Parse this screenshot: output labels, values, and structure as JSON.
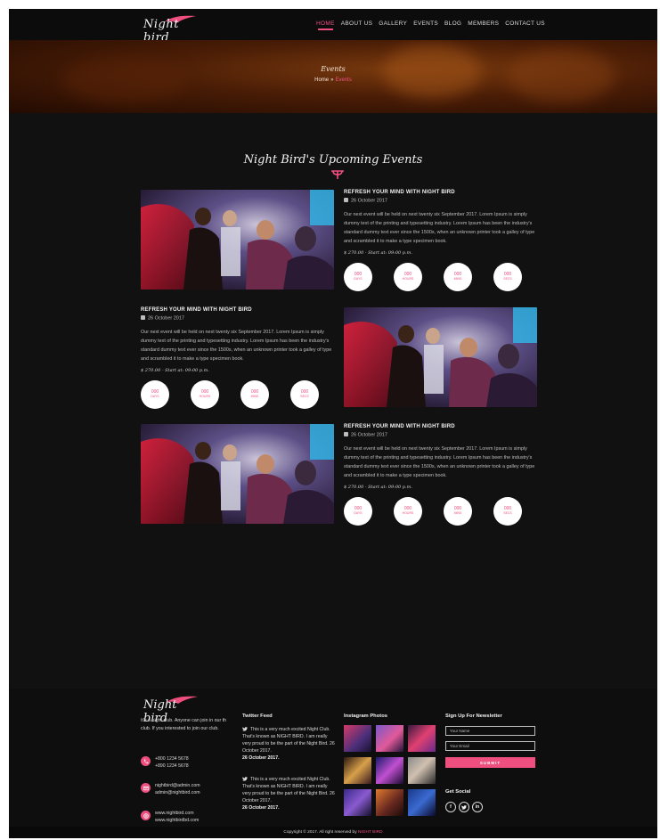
{
  "brand": {
    "logo_text": "Night bird",
    "accent": "#ef4f7e",
    "background": "#111112"
  },
  "nav": {
    "items": [
      {
        "label": "HOME",
        "active": true
      },
      {
        "label": "ABOUT US"
      },
      {
        "label": "GALLERY"
      },
      {
        "label": "EVENTS"
      },
      {
        "label": "BLOG"
      },
      {
        "label": "MEMBERS"
      },
      {
        "label": "CONTACT US"
      }
    ]
  },
  "banner": {
    "title": "Events",
    "breadcrumb": {
      "home": "Home",
      "separator": "»",
      "current": "Events"
    }
  },
  "section": {
    "title": "Night Bird's Upcoming Events"
  },
  "events": [
    {
      "title": "REFRESH YOUR MIND WITH NIGHT BIRD",
      "date": "26 October 2017",
      "description": "Our next event will be held on next twenty six September 2017. Lorem Ipsum is simply dummy text of the printing and typesetting industry. Lorem Ipsum has been the industry's standard dummy text ever since the 1500s, when an unknown printer took a galley of type and scrambled it to make a type specimen book.",
      "price": "$ 270.00 - Start at: 09:00 p.m.",
      "countdown": [
        {
          "value": "000",
          "unit": "DAYS"
        },
        {
          "value": "000",
          "unit": "HOURS"
        },
        {
          "value": "000",
          "unit": "MINS"
        },
        {
          "value": "000",
          "unit": "SECS"
        }
      ]
    },
    {
      "title": "REFRESH YOUR MIND WITH NIGHT BIRD",
      "date": "26 October 2017",
      "description": "Our next event will be held on next twenty six September 2017. Lorem Ipsum is simply dummy text of the printing and typesetting industry. Lorem Ipsum has been the industry's standard dummy text ever since the 1500s, when an unknown printer took a galley of type and scrambled it to make a type specimen book.",
      "price": "$ 270.00 - Start at: 09:00 p.m.",
      "countdown": [
        {
          "value": "000",
          "unit": "DAYS"
        },
        {
          "value": "000",
          "unit": "HOURS"
        },
        {
          "value": "000",
          "unit": "MINS"
        },
        {
          "value": "000",
          "unit": "SECS"
        }
      ]
    },
    {
      "title": "REFRESH YOUR MIND WITH NIGHT BIRD",
      "date": "26 October 2017",
      "description": "Our next event will be held on next twenty six September 2017. Lorem Ipsum is simply dummy text of the printing and typesetting industry. Lorem Ipsum has been the industry's standard dummy text ever since the 1500s, when an unknown printer took a galley of type and scrambled it to make a type specimen book.",
      "price": "$ 270.00 - Start at: 09:00 p.m.",
      "countdown": [
        {
          "value": "000",
          "unit": "DAYS"
        },
        {
          "value": "000",
          "unit": "HOURS"
        },
        {
          "value": "000",
          "unit": "MINS"
        },
        {
          "value": "000",
          "unit": "SECS"
        }
      ]
    }
  ],
  "footer": {
    "about": "It's a night club. Anyone can join in our th club. If you interested to join our club.",
    "phones": [
      "+800 1234 5678",
      "+890 1234 5678"
    ],
    "emails": [
      "nightbird@admin.com",
      "admin@nightbird.com"
    ],
    "websites": [
      "www.nightbird.com",
      "www.nightbirdbd.com"
    ],
    "twitter": {
      "heading": "Twitter Feed",
      "tweets": [
        {
          "text": "This is a very much excited Night Club. That's known as NIGHT BIRD. I am really very proud to be the part of the Night Bird. 26 October 2017.",
          "date": "26 October 2017."
        },
        {
          "text": "This is a very much excited Night Club. That's known as NIGHT BIRD. I am really very proud to be the part of the Night Bird. 26 October 2017.",
          "date": "26 October 2017."
        }
      ]
    },
    "instagram": {
      "heading": "Instagram Photos"
    },
    "newsletter": {
      "heading": "Sign Up For Newsletter",
      "name_placeholder": "Your Name",
      "email_placeholder": "Your Email",
      "submit": "SUBMIT"
    },
    "social": {
      "heading": "Get Social",
      "icons": [
        "facebook-icon",
        "twitter-icon",
        "linkedin-icon"
      ]
    },
    "copyright": {
      "text": "Copyright © 2017. All right reserved by",
      "brand": "NIGHT BIRD"
    }
  }
}
